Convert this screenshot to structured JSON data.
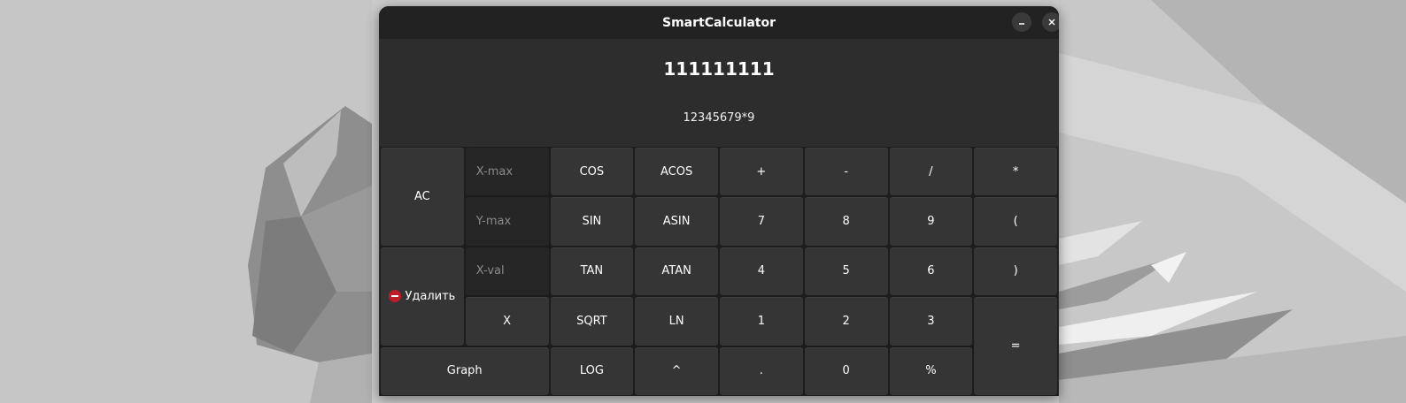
{
  "window": {
    "title": "SmartCalculator",
    "minimize_icon": "minimize-icon",
    "close_icon": "close-icon"
  },
  "display": {
    "result": "111111111",
    "expression": "12345679*9"
  },
  "inputs": {
    "xmax_placeholder": "X-max",
    "ymax_placeholder": "Y-max",
    "xval_placeholder": "X-val",
    "xmax_value": "",
    "ymax_value": "",
    "xval_value": ""
  },
  "keys": {
    "ac": "AC",
    "delete": "Удалить",
    "delete_icon": "remove-circle-icon",
    "graph": "Graph",
    "x": "X",
    "cos": "COS",
    "acos": "ACOS",
    "sin": "SIN",
    "asin": "ASIN",
    "tan": "TAN",
    "atan": "ATAN",
    "sqrt": "SQRT",
    "ln": "LN",
    "log": "LOG",
    "pow": "^",
    "plus": "+",
    "minus": "-",
    "divide": "/",
    "multiply": "*",
    "seven": "7",
    "eight": "8",
    "nine": "9",
    "lparen": "(",
    "four": "4",
    "five": "5",
    "six": "6",
    "rparen": ")",
    "one": "1",
    "two": "2",
    "three": "3",
    "equals": "=",
    "dot": ".",
    "zero": "0",
    "mod": "%"
  },
  "colors": {
    "window_bg": "#2c2c2c",
    "titlebar_bg": "#222222",
    "button_bg": "#353535",
    "delete_icon": "#c01c28"
  }
}
